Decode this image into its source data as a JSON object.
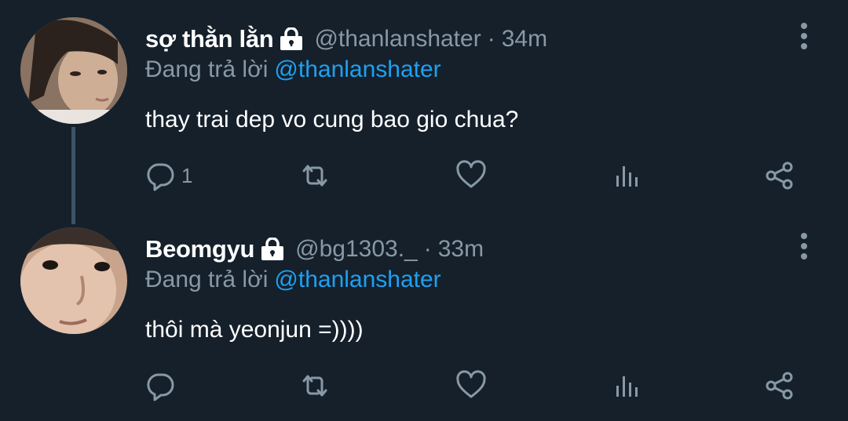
{
  "tweets": [
    {
      "display_name": "sợ thằn lằn",
      "handle": "@thanlanshater",
      "separator": "·",
      "time": "34m",
      "replying_label": "Đang trả lời",
      "replying_to": "@thanlanshater",
      "text": "thay trai dep vo cung bao gio chua?",
      "reply_count": "1",
      "protected": true
    },
    {
      "display_name": "Beomgyu",
      "handle": "@bg1303._",
      "separator": "·",
      "time": "33m",
      "replying_label": "Đang trả lời",
      "replying_to": "@thanlanshater",
      "text": "thôi mà yeonjun =))))",
      "reply_count": "",
      "protected": true
    }
  ],
  "icons": {
    "more": "more-vertical-icon",
    "lock": "lock-icon",
    "reply": "reply-bubble-icon",
    "retweet": "retweet-icon",
    "like": "heart-icon",
    "stats": "analytics-icon",
    "share": "share-icon"
  },
  "colors": {
    "background": "#15202b",
    "secondary_text": "#8899a6",
    "link": "#1da1f2",
    "primary_text": "#ffffff",
    "thread_line": "#3d5466"
  }
}
